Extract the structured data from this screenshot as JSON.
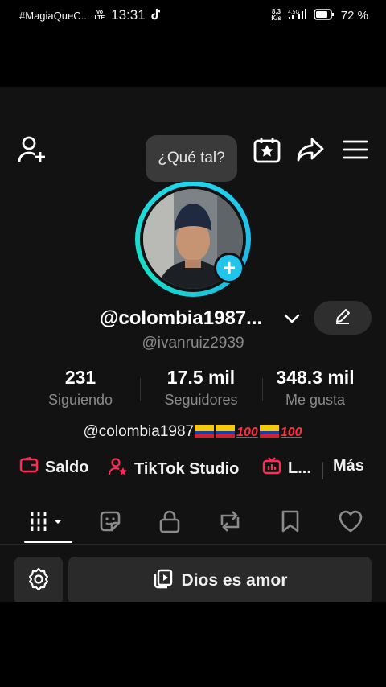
{
  "status_bar": {
    "notification": "#MagiaQueC...",
    "volte": "Vo\nLTE",
    "time": "13:31",
    "net_speed_value": "8,3",
    "net_speed_unit": "K/s",
    "signal": "4.5G",
    "battery": "72 %"
  },
  "profile": {
    "bubble_text": "¿Qué tal?",
    "display_name": "@colombia1987...",
    "username": "@ivanruiz2939",
    "bio_text": "@colombia1987"
  },
  "stats": [
    {
      "value": "231",
      "label": "Siguiendo"
    },
    {
      "value": "17.5 mil",
      "label": "Seguidores"
    },
    {
      "value": "348.3 mil",
      "label": "Me gusta"
    }
  ],
  "links": {
    "saldo": "Saldo",
    "studio": "TikTok Studio",
    "live": "L...",
    "more": "Más"
  },
  "tabs": [
    "videos",
    "reposts-stickers",
    "private",
    "reposts",
    "favorites",
    "liked"
  ],
  "playlist_button": "Dios es amor",
  "colors": {
    "accent_pink": "#fe2c55",
    "ring_cyan": "#20d5ec",
    "background": "#121212"
  },
  "icons": {
    "add_friend": "add-user-icon",
    "calendar": "calendar-star-icon",
    "share": "share-icon",
    "menu": "hamburger-menu-icon"
  }
}
